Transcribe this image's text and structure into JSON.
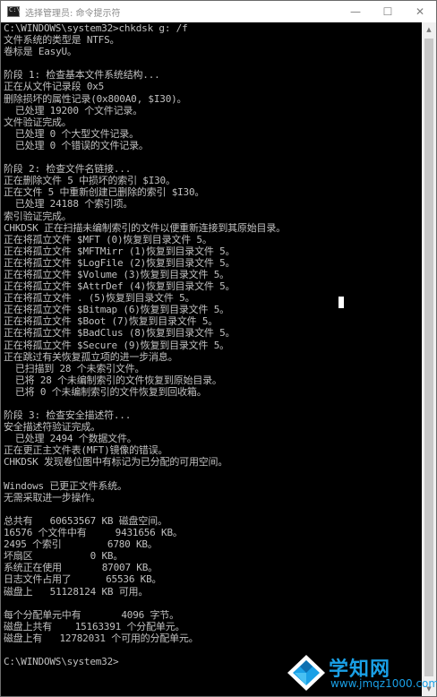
{
  "window": {
    "title": "选择管理员: 命令提示符",
    "app_icon": "cmd-icon",
    "controls": {
      "minimize": "—",
      "maximize": "☐",
      "close": "✕"
    }
  },
  "console": {
    "lines": [
      "C:\\WINDOWS\\system32>chkdsk g: /f",
      "文件系统的类型是 NTFS。",
      "卷标是 EasyU。",
      "",
      "阶段 1: 检查基本文件系统结构...",
      "正在从文件记录段 0x5",
      "删除损坏的属性记录(0x800A0, $I30)。",
      "  已处理 19200 个文件记录。",
      "文件验证完成。",
      "  已处理 0 个大型文件记录。",
      "  已处理 0 个错误的文件记录。",
      "",
      "阶段 2: 检查文件名链接...",
      "正在删除文件 5 中损坏的索引 $I30。",
      "正在文件 5 中重新创建已删除的索引 $I30。",
      "  已处理 24188 个索引项。",
      "索引验证完成。",
      "CHKDSK 正在扫描未编制索引的文件以便重新连接到其原始目录。",
      "正在将孤立文件 $MFT (0)恢复到目录文件 5。",
      "正在将孤立文件 $MFTMirr (1)恢复到目录文件 5。",
      "正在将孤立文件 $LogFile (2)恢复到目录文件 5。",
      "正在将孤立文件 $Volume (3)恢复到目录文件 5。",
      "正在将孤立文件 $AttrDef (4)恢复到目录文件 5。",
      "正在将孤立文件 . (5)恢复到目录文件 5。",
      "正在将孤立文件 $Bitmap (6)恢复到目录文件 5。",
      "正在将孤立文件 $Boot (7)恢复到目录文件 5。",
      "正在将孤立文件 $BadClus (8)恢复到目录文件 5。",
      "正在将孤立文件 $Secure (9)恢复到目录文件 5。",
      "正在跳过有关恢复孤立项的进一步消息。",
      "  已扫描到 28 个未索引文件。",
      "  已将 28 个未编制索引的文件恢复到原始目录。",
      "  已将 0 个未编制索引的文件恢复到回收箱。",
      "",
      "阶段 3: 检查安全描述符...",
      "安全描述符验证完成。",
      "  已处理 2494 个数据文件。",
      "正在更正主文件表(MFT)镜像的错误。",
      "CHKDSK 发现卷位图中有标记为已分配的可用空间。",
      "",
      "Windows 已更正文件系统。",
      "无需采取进一步操作。",
      "",
      "总共有   60653567 KB 磁盘空间。",
      "16576 个文件中有     9431656 KB。",
      "2495 个索引        6780 KB。",
      "坏扇区          0 KB。",
      "系统正在使用       87007 KB。",
      "日志文件占用了      65536 KB。",
      "磁盘上   51128124 KB 可用。",
      "",
      "每个分配单元中有       4096 字节。",
      "磁盘上共有    15163391 个分配单元。",
      "磁盘上有   12782031 个可用的分配单元。",
      "",
      "C:\\WINDOWS\\system32>"
    ]
  },
  "watermark": {
    "title": "学知网",
    "url": "www.jmqz1000.com",
    "logo_icon": "diamond-logo-icon"
  },
  "colors": {
    "console_bg": "#000000",
    "console_text": "#c0c0c0",
    "watermark": "#1aa0e6"
  }
}
